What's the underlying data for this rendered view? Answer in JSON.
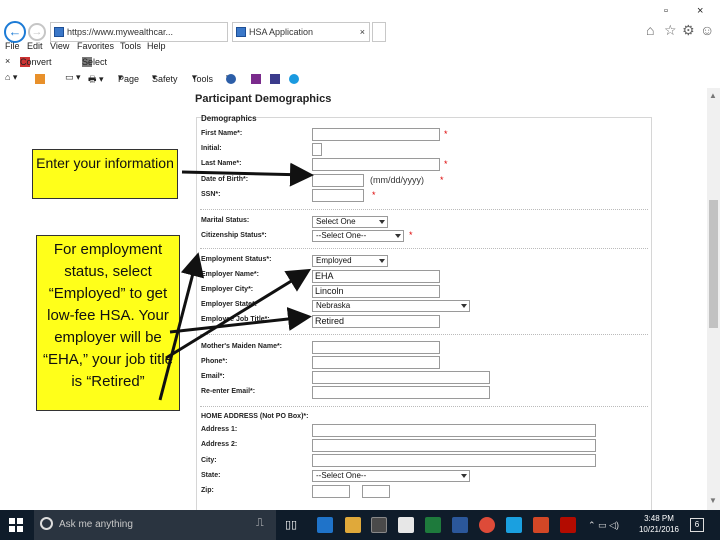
{
  "browser": {
    "address_url": "https://www.mywealthcar...",
    "tab_title": "HSA Application",
    "tab_close": "×",
    "menu": [
      "File",
      "Edit",
      "View",
      "Favorites",
      "Tools",
      "Help"
    ],
    "linkbar": {
      "close": "×",
      "convert": "Convert",
      "select": "Select"
    },
    "commands": {
      "page": "Page",
      "safety": "Safety",
      "tools": "Tools"
    }
  },
  "page": {
    "section_title": "Participant Demographics",
    "subsection": "Demographics",
    "fields": {
      "first_name": "First Name*:",
      "initial": "Initial:",
      "last_name": "Last Name*:",
      "dob": "Date of Birth*:",
      "dob_hint": "(mm/dd/yyyy)",
      "ssn": "SSN*:",
      "marital_status": "Marital Status:",
      "marital_value": "Select One",
      "citizenship": "Citizenship Status*:",
      "citizenship_value": "--Select One--",
      "employment_status": "Employment Status*:",
      "employment_value": "Employed",
      "employer_name": "Employer Name*:",
      "employer_name_value": "EHA",
      "employer_city": "Employer City*:",
      "employer_city_value": "Lincoln",
      "employer_state": "Employer State*:",
      "employer_state_value": "Nebraska",
      "job_title": "Employee Job Title*:",
      "job_title_value": "Retired",
      "maiden_name": "Mother's Maiden Name*:",
      "phone": "Phone*:",
      "email": "Email*:",
      "reenter_email": "Re-enter Email*:",
      "home_address": "HOME ADDRESS (Not PO Box)*:",
      "address1": "Address 1:",
      "address2": "Address 2:",
      "city": "City:",
      "state": "State:",
      "state_value": "--Select One--",
      "zip": "Zip:"
    },
    "required_mark": "*"
  },
  "callouts": {
    "info": "Enter your information",
    "employment": "For employment status, select “Employed” to get low-fee HSA. Your employer will be “EHA,” your job title is “Retired”"
  },
  "taskbar": {
    "search_placeholder": "Ask me anything",
    "time": "3:48 PM",
    "date": "10/21/2016",
    "notification_count": "6"
  },
  "colors": {
    "callout": "#ffff1a",
    "required": "#dd0000",
    "taskbar": "#0f1c2a"
  }
}
